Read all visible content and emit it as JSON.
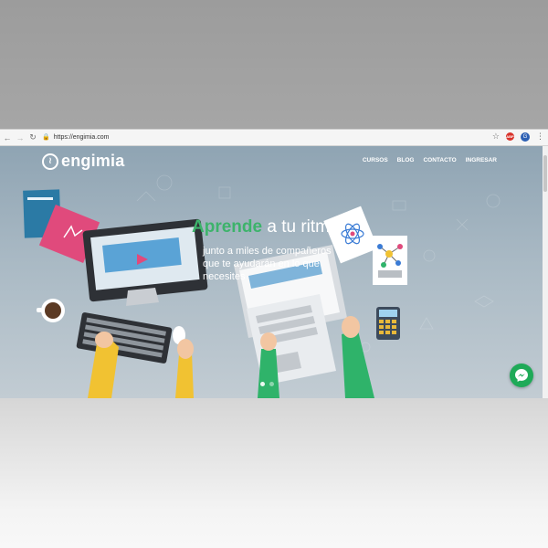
{
  "browser": {
    "url": "https://engimia.com",
    "ext_badge": "ABP",
    "profile_initial": "G",
    "back_icon": "arrow-left",
    "forward_icon": "arrow-right",
    "reload_icon": "reload",
    "star_icon": "star",
    "menu_icon": "vertical-dots"
  },
  "site": {
    "logo_text": "engimia",
    "nav": [
      "CURSOS",
      "BLOG",
      "CONTACTO",
      "INGRESAR"
    ],
    "hero": {
      "title_accent": "Aprende",
      "title_rest": " a tu ritmo",
      "subtitle_lines": [
        "junto a miles de compañeros",
        "que te ayudarán en lo que",
        "necesites"
      ]
    },
    "slider": {
      "count": 2,
      "active": 1
    },
    "colors": {
      "accent": "#3db36b",
      "messenger": "#1faa58"
    }
  }
}
